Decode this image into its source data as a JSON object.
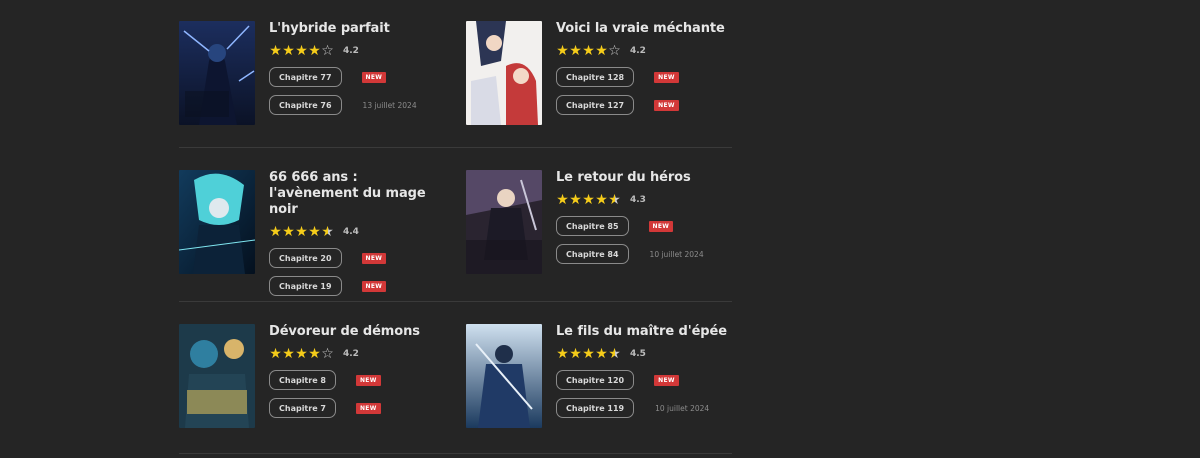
{
  "series": [
    {
      "title": "L'hybride parfait",
      "stars": [
        "full",
        "full",
        "full",
        "full",
        "empty"
      ],
      "rating": "4.2",
      "chapters": [
        {
          "label": "Chapitre 77",
          "badge": "NEW",
          "date": ""
        },
        {
          "label": "Chapitre 76",
          "badge": "",
          "date": "13 juillet 2024"
        }
      ]
    },
    {
      "title": "Voici la vraie méchante",
      "stars": [
        "full",
        "full",
        "full",
        "full",
        "empty"
      ],
      "rating": "4.2",
      "chapters": [
        {
          "label": "Chapitre 128",
          "badge": "NEW",
          "date": ""
        },
        {
          "label": "Chapitre 127",
          "badge": "NEW",
          "date": ""
        }
      ]
    },
    {
      "title": "66 666 ans : l'avènement du mage noir",
      "stars": [
        "full",
        "full",
        "full",
        "full",
        "half"
      ],
      "rating": "4.4",
      "chapters": [
        {
          "label": "Chapitre 20",
          "badge": "NEW",
          "date": ""
        },
        {
          "label": "Chapitre 19",
          "badge": "NEW",
          "date": ""
        }
      ]
    },
    {
      "title": "Le retour du héros",
      "stars": [
        "full",
        "full",
        "full",
        "full",
        "half"
      ],
      "rating": "4.3",
      "chapters": [
        {
          "label": "Chapitre 85",
          "badge": "NEW",
          "date": ""
        },
        {
          "label": "Chapitre 84",
          "badge": "",
          "date": "10 juillet 2024"
        }
      ]
    },
    {
      "title": "Dévoreur de démons",
      "stars": [
        "full",
        "full",
        "full",
        "full",
        "empty"
      ],
      "rating": "4.2",
      "chapters": [
        {
          "label": "Chapitre 8",
          "badge": "NEW",
          "date": ""
        },
        {
          "label": "Chapitre 7",
          "badge": "NEW",
          "date": ""
        }
      ]
    },
    {
      "title": "Le fils du maître d'épée",
      "stars": [
        "full",
        "full",
        "full",
        "full",
        "half"
      ],
      "rating": "4.5",
      "chapters": [
        {
          "label": "Chapitre 120",
          "badge": "NEW",
          "date": ""
        },
        {
          "label": "Chapitre 119",
          "badge": "",
          "date": "10 juillet 2024"
        }
      ]
    }
  ],
  "colors": {
    "background": "#252525",
    "star": "#f5cc1a",
    "badge": "#d23838"
  }
}
